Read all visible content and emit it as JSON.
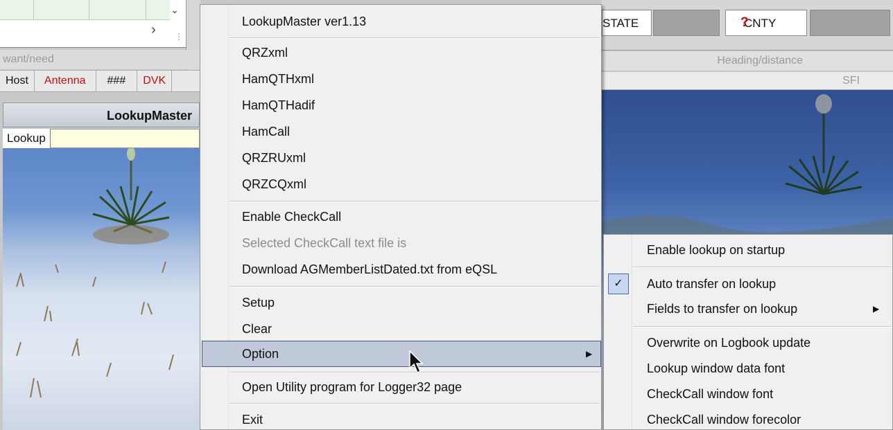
{
  "background": {
    "want_need_label": "want/need",
    "columns": [
      "Host",
      "Antenna",
      "###",
      "DVK"
    ],
    "lookup_panel_title": "LookupMaster",
    "lookup_tab": "Lookup",
    "state_label": "STATE",
    "cnty_label": "CNTY",
    "cnty_flag": "?",
    "heading_label": "Heading/distance",
    "sfi_label": "SFI"
  },
  "menu": {
    "title": "LookupMaster ver1.13",
    "providers": [
      "QRZxml",
      "HamQTHxml",
      "HamQTHadif",
      "HamCall",
      "QRZRUxml",
      "QRZCQxml"
    ],
    "enable_checkcall": "Enable CheckCall",
    "selected_checkcall": "Selected CheckCall text file is",
    "download": "Download AGMemberListDated.txt from eQSL",
    "setup": "Setup",
    "clear": "Clear",
    "option": "Option",
    "open_utility": "Open Utility program for Logger32 page",
    "exit": "Exit"
  },
  "submenu": {
    "enable_lookup": "Enable lookup on startup",
    "auto_transfer": "Auto transfer on lookup",
    "auto_transfer_checked": true,
    "fields_to_transfer": "Fields to transfer on lookup",
    "overwrite": "Overwrite on Logbook update",
    "lookup_font": "Lookup window data font",
    "checkcall_font": "CheckCall window font",
    "checkcall_forecolor": "CheckCall window forecolor"
  }
}
